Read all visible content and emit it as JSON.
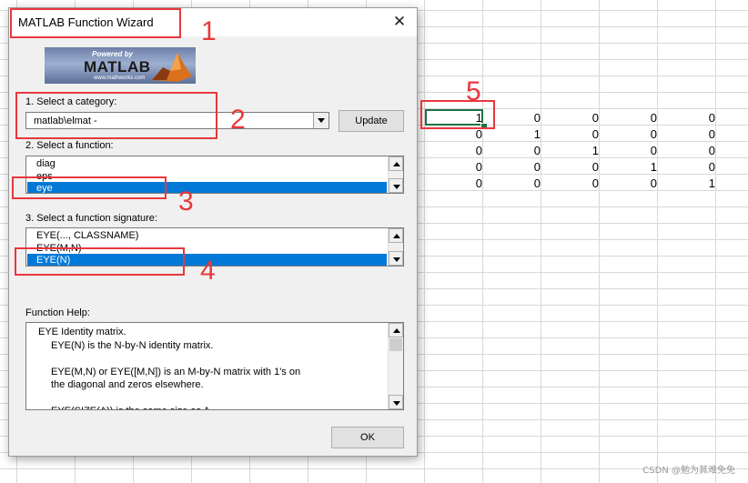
{
  "dialog": {
    "title": "MATLAB Function Wizard",
    "close": "✕",
    "logo": {
      "powered": "Powered by",
      "name": "MATLAB",
      "url": "www.mathworks.com"
    },
    "category_label": "1. Select a category:",
    "category_value": "matlab\\elmat -",
    "update_label": "Update",
    "function_label": "2. Select a function:",
    "functions": [
      "diag",
      "eps",
      "eye"
    ],
    "function_selected_index": 2,
    "signature_label": "3. Select a function signature:",
    "signatures": [
      "EYE(..., CLASSNAME)",
      "EYE(M,N)",
      "EYE(N)"
    ],
    "signature_selected_index": 2,
    "help_label": "Function Help:",
    "help_lines": [
      "EYE Identity matrix.",
      "EYE(N) is the N-by-N identity matrix.",
      "",
      "EYE(M,N) or EYE([M,N]) is an M-by-N matrix with 1's on",
      "the diagonal and zeros elsewhere.",
      "",
      "EYE(SIZE(A)) is the same size as A."
    ],
    "ok_label": "OK"
  },
  "sheet": {
    "matrix": [
      [
        "1",
        "0",
        "0",
        "0",
        "0"
      ],
      [
        "0",
        "1",
        "0",
        "0",
        "0"
      ],
      [
        "0",
        "0",
        "1",
        "0",
        "0"
      ],
      [
        "0",
        "0",
        "0",
        "1",
        "0"
      ],
      [
        "0",
        "0",
        "0",
        "0",
        "1"
      ]
    ]
  },
  "annotations": [
    "1",
    "2",
    "3",
    "4",
    "5"
  ],
  "annotation_color": "#e8383d",
  "selection_color": "#0078d7",
  "watermark": "CSDN @勉为其难免免"
}
